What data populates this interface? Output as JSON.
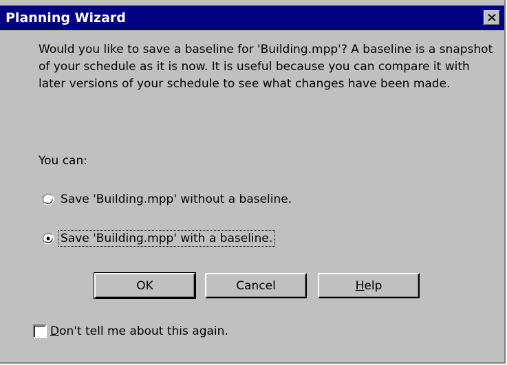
{
  "window": {
    "title": "Planning Wizard",
    "close_label": "×",
    "colors": {
      "titlebar": "#000080",
      "face": "#c0c0c0"
    }
  },
  "message": {
    "body": "Would you like to save a baseline for 'Building.mpp'?  A baseline is a snapshot of your schedule as it is now.  It is useful because you can compare it with later versions of your schedule to see what changes have been made.",
    "options_intro": "You can:"
  },
  "options": [
    {
      "label": "Save 'Building.mpp' without a baseline.",
      "selected": false
    },
    {
      "label": "Save 'Building.mpp' with a baseline.",
      "selected": true
    }
  ],
  "buttons": {
    "ok": "OK",
    "cancel": "Cancel",
    "help_mnemonic": "H",
    "help_rest": "elp"
  },
  "checkbox": {
    "mnemonic": "D",
    "rest": "on't tell me about this again.",
    "checked": false
  }
}
